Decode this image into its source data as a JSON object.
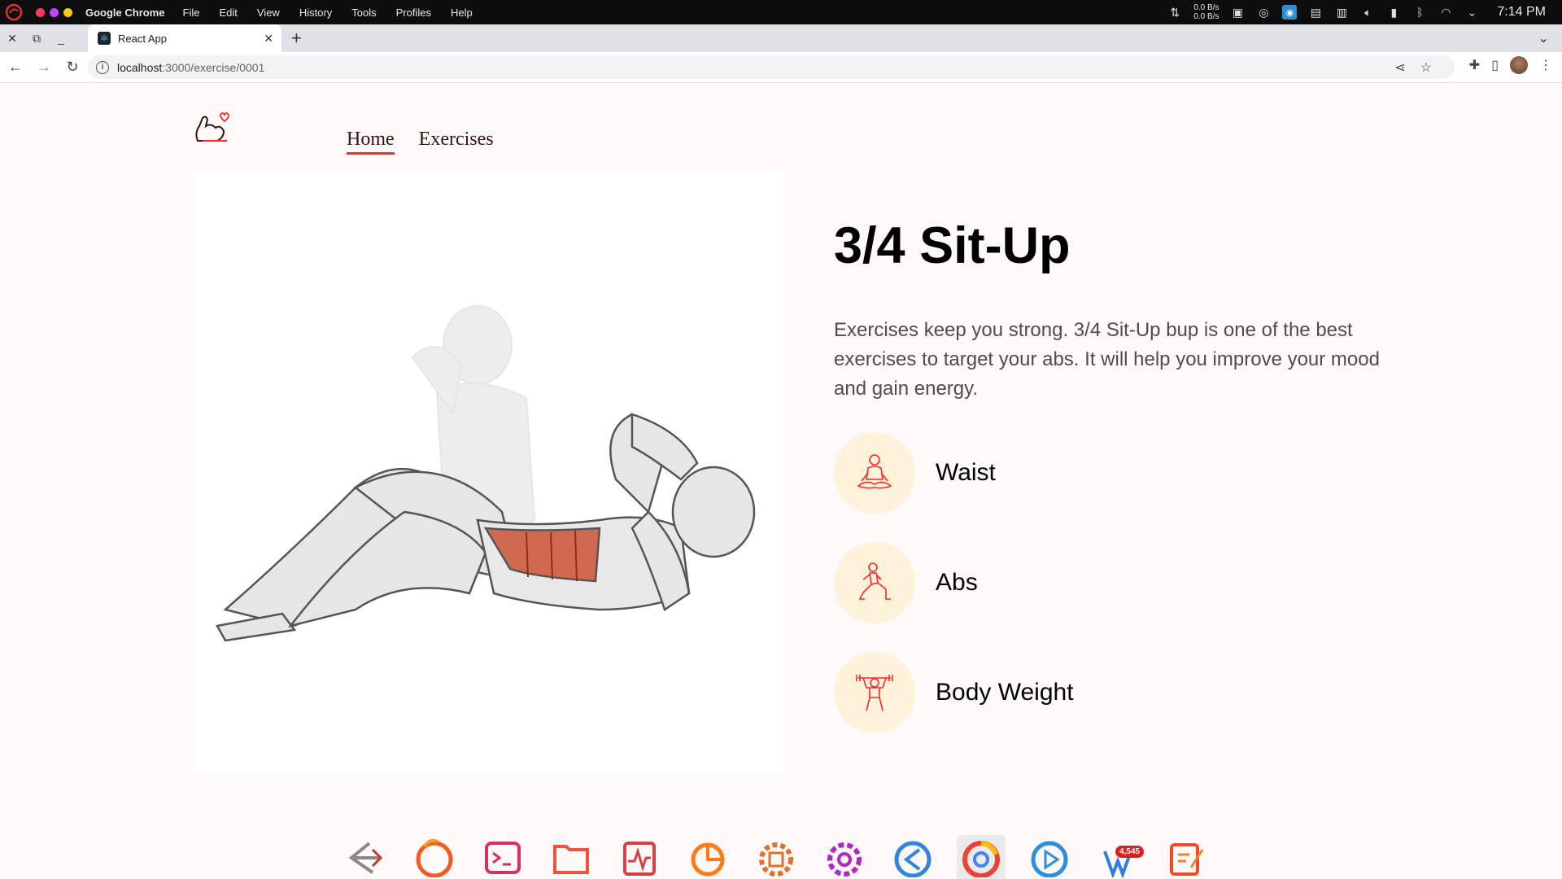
{
  "system_bar": {
    "app_name": "Google Chrome",
    "menu": [
      "File",
      "Edit",
      "View",
      "History",
      "Tools",
      "Profiles",
      "Help"
    ],
    "net_down": "0.0 B/s",
    "net_up": "0.0 B/s",
    "clock": "7:14 PM"
  },
  "browser": {
    "tab_title": "React App",
    "url_host": "localhost",
    "url_path": ":3000/exercise/0001"
  },
  "site": {
    "nav": {
      "home": "Home",
      "exercises": "Exercises"
    },
    "accent_color": "#ff2625"
  },
  "exercise": {
    "name": "3/4 Sit-Up",
    "description": "Exercises keep you strong. 3/4 Sit-Up bup is one of the best exercises to target your abs. It will help you improve your mood and gain energy.",
    "details": [
      {
        "label": "Waist",
        "icon": "meditation-icon"
      },
      {
        "label": "Abs",
        "icon": "lunge-icon"
      },
      {
        "label": "Body Weight",
        "icon": "weightlifter-icon"
      }
    ]
  },
  "dock": {
    "items": [
      "linux-logo-icon",
      "firefox-icon",
      "terminal-icon",
      "files-icon",
      "system-monitor-icon",
      "disk-usage-icon",
      "software-center-icon",
      "settings-icon",
      "vscode-icon",
      "chrome-icon",
      "video-player-icon",
      "feedreader-icon",
      "text-editor-icon"
    ],
    "notification_count": "4,545"
  }
}
